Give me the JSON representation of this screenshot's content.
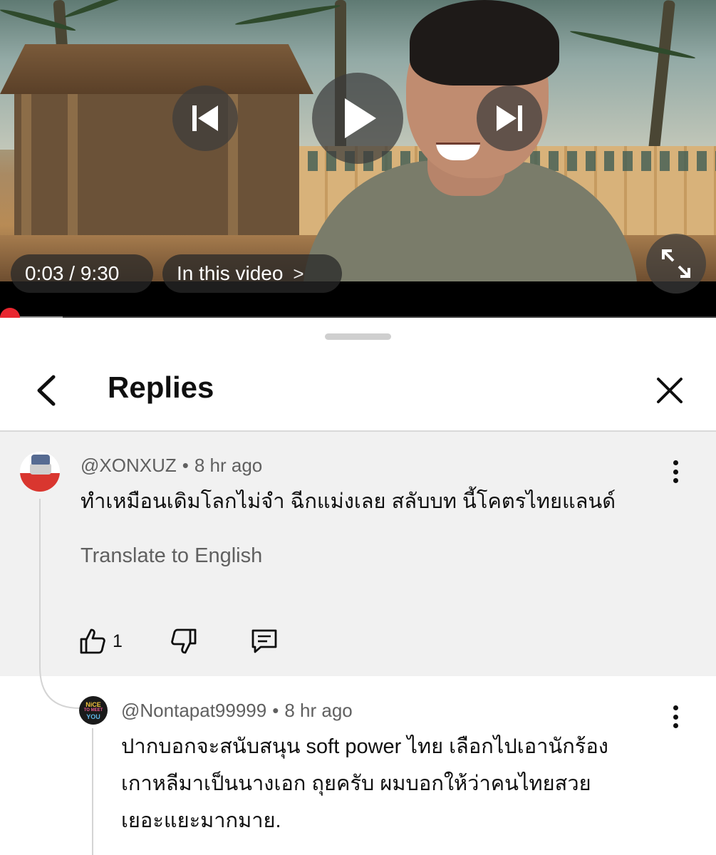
{
  "player": {
    "time_current": "0:03",
    "time_separator": " / ",
    "time_total": "9:30",
    "chapters_label": "In this video",
    "chapters_chevron": ">",
    "progress_fraction": 0.005,
    "buffer_fraction": 0.088,
    "controls": [
      "previous-icon",
      "play-icon",
      "next-icon",
      "fullscreen-icon"
    ],
    "accent_color": "#e8262f"
  },
  "sheet": {
    "title": "Replies",
    "back_icon": "chevron-left-icon",
    "close_icon": "close-icon"
  },
  "comment": {
    "author": "@XONXUZ",
    "dot": "•",
    "time": "8 hr ago",
    "text": "ทำเหมือนเดิมโลกไม่จำ  ฉีกแม่งเลย สลับบท นี้โคตรไทยแลนด์",
    "translate_label": "Translate to English",
    "like_count": "1",
    "action_icons": [
      "thumbs-up-icon",
      "thumbs-down-icon",
      "reply-icon"
    ],
    "menu_icon": "more-vertical-icon",
    "background": "#f1f1f1"
  },
  "reply": {
    "author": "@Nontapat99999",
    "dot": "•",
    "time": "8 hr ago",
    "lines": [
      "ปากบอกจะสนับสนุน soft power ไทย เลือกไปเอานักร้อง",
      "เกาหลีมาเป็นนางเอก ถุยครับ ผมบอกให้ว่าคนไทยสวย",
      "เยอะแยะมากมาย."
    ],
    "avatar_text": [
      "NiCE",
      "TO MEET",
      "YOU"
    ],
    "menu_icon": "more-vertical-icon"
  }
}
